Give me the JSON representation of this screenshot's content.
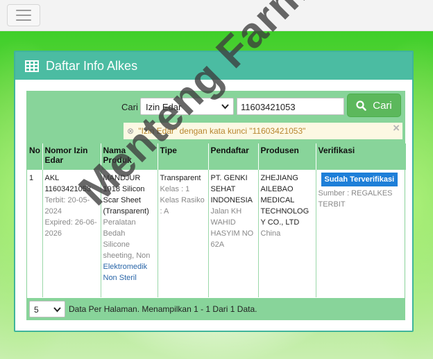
{
  "panel": {
    "title": "Daftar Info Alkes"
  },
  "search": {
    "label": "Cari",
    "field_selected": "Izin Edar",
    "query": "11603421053",
    "button_label": "Cari",
    "alert_text": "\"Izin Edar\" dengan kata kunci \"11603421053\"",
    "alert_close": "×"
  },
  "table": {
    "headers": [
      "No",
      "Nomor Izin Edar",
      "Nama Produk",
      "Tipe",
      "Pendaftar",
      "Produsen",
      "Verifikasi"
    ],
    "rows": [
      {
        "no": "1",
        "izin": "AKL 11603421053",
        "terbit": "Terbit: 20-05-2024",
        "expired": "Expired: 26-06-2026",
        "produk": "MANDJUR 1918 Silicon Scar Sheet (Transparent)",
        "kategori": "Peralatan Bedah",
        "sub_prefix": "Silicone sheeting, Non",
        "sub_link": "Elektromedik Non Steril",
        "tipe": "Transparent",
        "kelas": "Kelas : 1",
        "risiko": "Kelas Rasiko : A",
        "pendaftar": "PT. GENKI SEHAT INDONESIA",
        "alamat": "Jalan KH WAHID HASYIM NO 62A",
        "produsen": "ZHEJIANG AILEBAO MEDICAL TECHNOLOGY CO., LTD",
        "negara": "China",
        "verifikasi": "Sudah Terverifikasi",
        "sumber": "Sumber : REGALKES TERBIT"
      }
    ]
  },
  "footer": {
    "per_page": "5",
    "info": "Data Per Halaman. Menampilkan 1 - 1 Dari 1 Data."
  },
  "watermark": "Menteng Farma",
  "colors": {
    "header_teal": "#4bbca2",
    "table_green": "#88d49a",
    "search_button": "#5cb85c",
    "badge_blue": "#1e7fd8"
  }
}
